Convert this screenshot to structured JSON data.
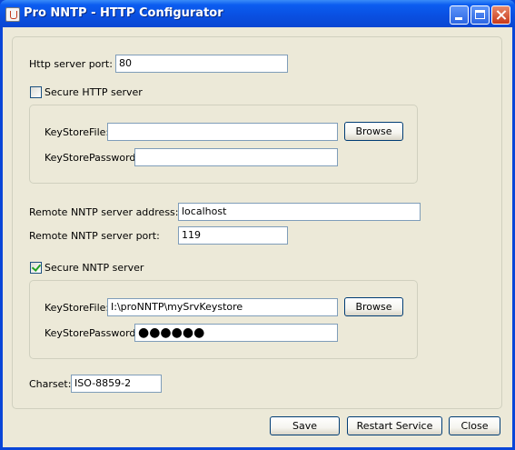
{
  "window": {
    "title": "Pro NNTP - HTTP Configurator"
  },
  "http": {
    "port_label": "Http server port:",
    "port_value": "80",
    "secure_label": "Secure HTTP server",
    "secure_checked": false,
    "keystore_file_label": "KeyStoreFile:",
    "keystore_file_value": "",
    "keystore_password_label": "KeyStorePassword:",
    "keystore_password_value": "",
    "browse_label": "Browse"
  },
  "nntp": {
    "address_label": "Remote NNTP server address:",
    "address_value": "localhost",
    "port_label": "Remote NNTP server port:",
    "port_value": "119",
    "secure_label": "Secure NNTP server",
    "secure_checked": true,
    "keystore_file_label": "KeyStoreFile:",
    "keystore_file_value": "I:\\proNNTP\\mySrvKeystore",
    "keystore_password_label": "KeyStorePassword:",
    "keystore_password_value": "●●●●●●",
    "browse_label": "Browse"
  },
  "charset": {
    "label": "Charset:",
    "value": "ISO-8859-2"
  },
  "buttons": {
    "save": "Save",
    "restart": "Restart Service",
    "close": "Close"
  }
}
